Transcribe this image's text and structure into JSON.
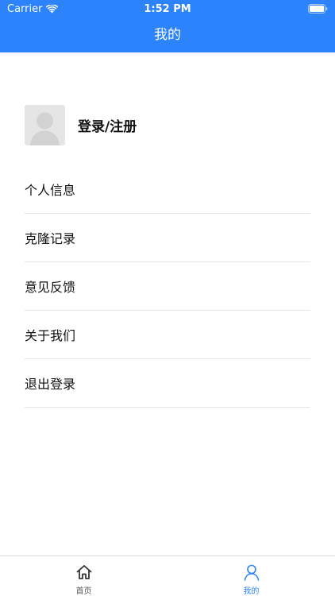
{
  "status_bar": {
    "carrier": "Carrier",
    "time": "1:52 PM",
    "icons": [
      "wifi-icon",
      "battery-icon"
    ]
  },
  "nav": {
    "title": "我的"
  },
  "profile": {
    "login_label": "登录/注册",
    "avatar_icon": "user-avatar-placeholder-icon"
  },
  "menu": {
    "items": [
      {
        "label": "个人信息"
      },
      {
        "label": "克隆记录"
      },
      {
        "label": "意见反馈"
      },
      {
        "label": "关于我们"
      },
      {
        "label": "退出登录"
      }
    ]
  },
  "tabbar": {
    "tabs": [
      {
        "label": "首页",
        "icon": "home-icon",
        "active": false
      },
      {
        "label": "我的",
        "icon": "user-icon",
        "active": true
      }
    ]
  },
  "colors": {
    "primary": "#2c83fc",
    "text": "#111111",
    "divider": "#e6e6e6",
    "avatar_bg": "#e5e5e5"
  }
}
